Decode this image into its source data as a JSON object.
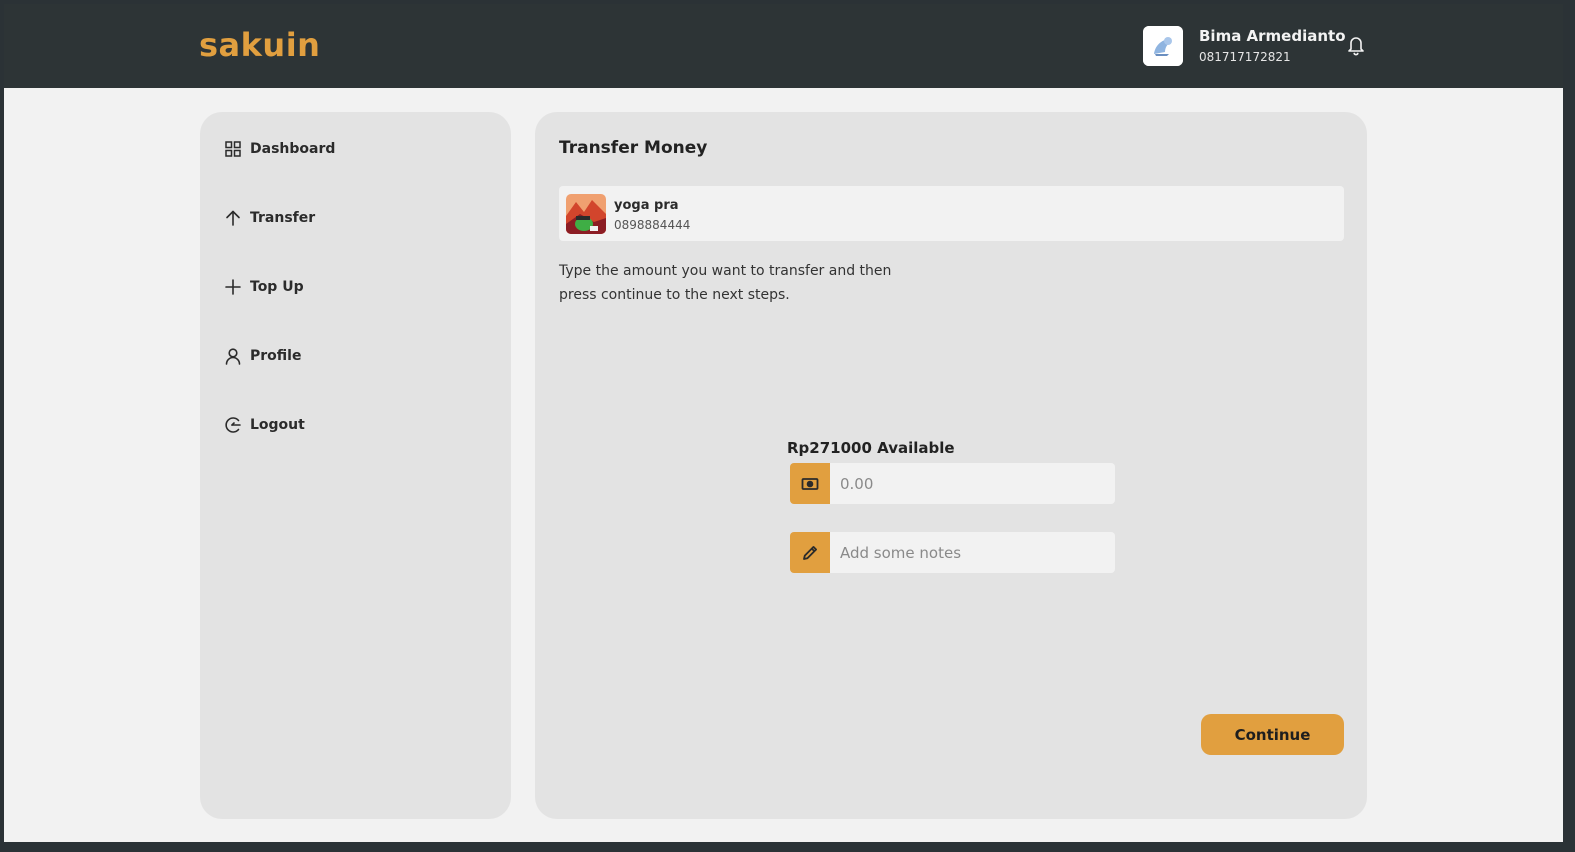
{
  "brand": {
    "name": "sakuin",
    "color": "#e19f3f"
  },
  "user": {
    "name": "Bima Armedianto",
    "phone": "081717172821"
  },
  "header_icons": {
    "notification": "bell-icon"
  },
  "sidebar": {
    "items": [
      {
        "label": "Dashboard",
        "icon": "grid-icon"
      },
      {
        "label": "Transfer",
        "icon": "arrow-up-icon"
      },
      {
        "label": "Top Up",
        "icon": "plus-icon"
      },
      {
        "label": "Profile",
        "icon": "user-icon"
      },
      {
        "label": "Logout",
        "icon": "logout-icon"
      }
    ]
  },
  "main": {
    "title": "Transfer Money",
    "recipient": {
      "name": "yoga pra",
      "phone": "0898884444"
    },
    "instruction": "Type the amount you want to transfer and then press continue to the next steps.",
    "balance_text": "Rp271000 Available",
    "amount_input": {
      "placeholder": "0.00",
      "value": "",
      "icon": "money-icon"
    },
    "notes_input": {
      "placeholder": "Add some notes",
      "value": "",
      "icon": "pencil-icon"
    },
    "continue_label": "Continue"
  },
  "colors": {
    "accent": "#e19f3f",
    "topbar": "#2d3436",
    "panel": "#e3e3e3",
    "background": "#f2f2f2"
  }
}
